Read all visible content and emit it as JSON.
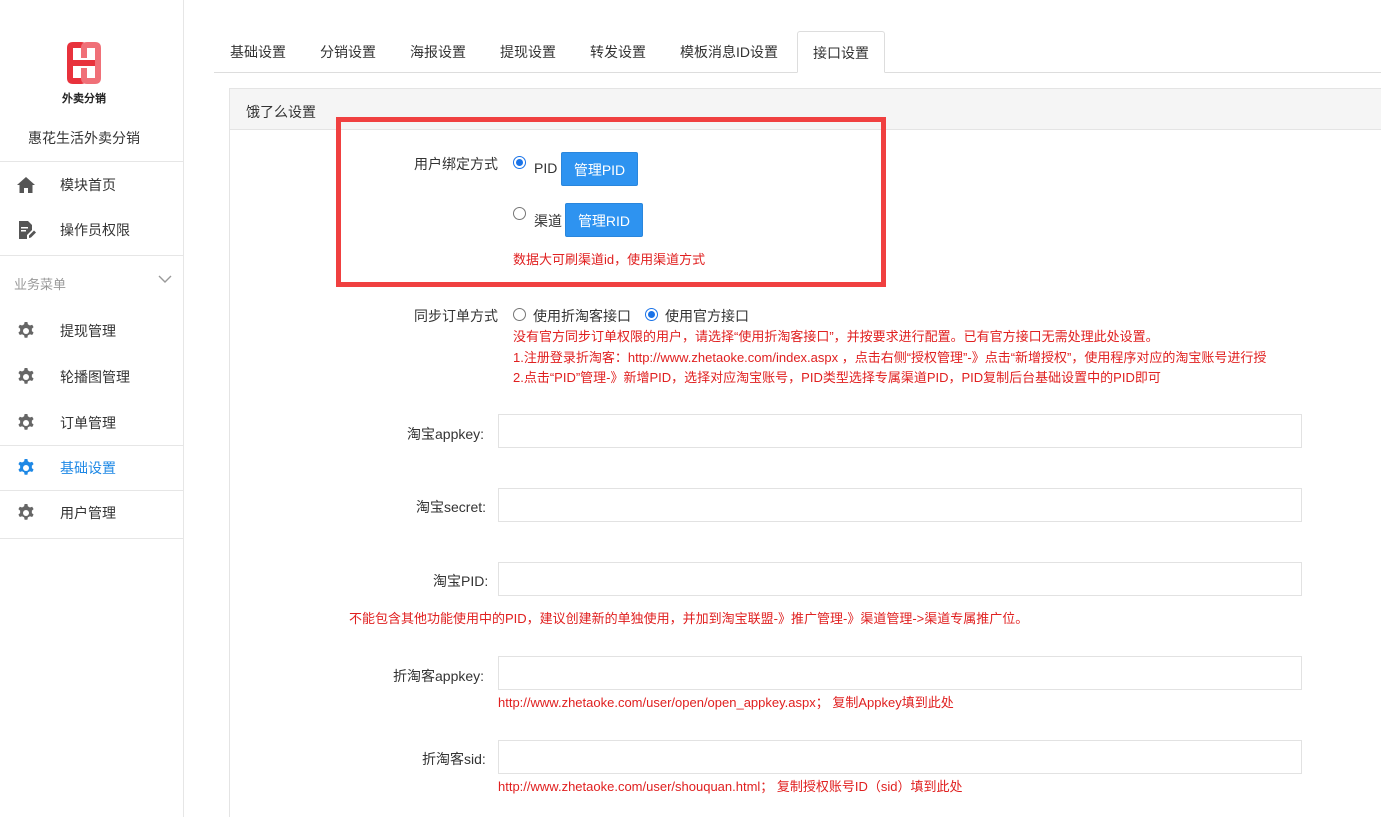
{
  "sidebar": {
    "logo_caption": "外卖分销",
    "site_name": "惠花生活外卖分销",
    "top_items": [
      {
        "label": "模块首页",
        "icon": "home-icon"
      },
      {
        "label": "操作员权限",
        "icon": "document-edit-icon"
      }
    ],
    "section_label": "业务菜单",
    "items": [
      {
        "label": "提现管理",
        "icon": "gear-icon"
      },
      {
        "label": "轮播图管理",
        "icon": "gear-icon"
      },
      {
        "label": "订单管理",
        "icon": "gear-icon"
      },
      {
        "label": "基础设置",
        "icon": "gear-icon",
        "active": true
      },
      {
        "label": "用户管理",
        "icon": "gear-icon"
      }
    ]
  },
  "tabs": [
    "基础设置",
    "分销设置",
    "海报设置",
    "提现设置",
    "转发设置",
    "模板消息ID设置",
    "接口设置"
  ],
  "active_tab": "接口设置",
  "panel": {
    "title": "饿了么设置",
    "bind_mode": {
      "label": "用户绑定方式",
      "option_pid": "PID",
      "btn_pid": "管理PID",
      "option_channel": "渠道",
      "btn_rid": "管理RID",
      "note": "数据大可刷渠道id，使用渠道方式",
      "selected": "PID"
    },
    "sync_mode": {
      "label": "同步订单方式",
      "option_zhetaoke": "使用折淘客接口",
      "option_official": "使用官方接口",
      "selected": "使用官方接口",
      "note1": "没有官方同步订单权限的用户，请选择“使用折淘客接口”，并按要求进行配置。已有官方接口无需处理此处设置。",
      "note2": "1.注册登录折淘客：http://www.zhetaoke.com/index.aspx ，点击右侧“授权管理”-》点击“新增授权”，使用程序对应的淘宝账号进行授",
      "note3": "2.点击“PID”管理-》新增PID，选择对应淘宝账号，PID类型选择专属渠道PID，PID复制后台基础设置中的PID即可"
    },
    "taobao_appkey": {
      "label": "淘宝appkey:",
      "value": ""
    },
    "taobao_secret": {
      "label": "淘宝secret:",
      "value": ""
    },
    "taobao_pid": {
      "label": "淘宝PID:",
      "value": "",
      "note": "不能包含其他功能使用中的PID，建议创建新的单独使用，并加到淘宝联盟-》推广管理-》渠道管理->渠道专属推广位。"
    },
    "zhetaoke_appkey": {
      "label": "折淘客appkey:",
      "value": "",
      "note": "http://www.zhetaoke.com/user/open/open_appkey.aspx； 复制Appkey填到此处"
    },
    "zhetaoke_sid": {
      "label": "折淘客sid:",
      "value": "",
      "note": "http://www.zhetaoke.com/user/shouquan.html； 复制授权账号ID（sid）填到此处"
    }
  },
  "colors": {
    "accent": "#2e93f0",
    "active_menu": "#1e88e5",
    "note_red": "#e02020",
    "highlight": "#f04040"
  }
}
